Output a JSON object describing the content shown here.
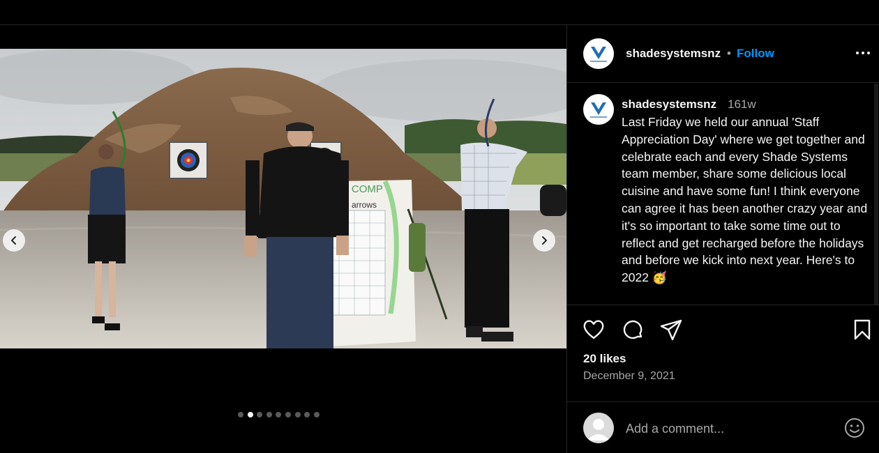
{
  "post": {
    "username": "shadesystemsnz",
    "follow_label": "Follow",
    "separator": "•",
    "caption_username": "shadesystemsnz",
    "time_ago": "161w",
    "caption": "Last Friday we held our annual 'Staff Appreciation Day' where we get together and celebrate each and every Shade Systems team member, share some delicious local cuisine and have some fun! I think everyone can agree it has been another crazy year and it's so important to take some time out to reflect and get recharged before the holidays and before we kick into next year. Here's to 2022 🥳",
    "likes": "20 likes",
    "date": "December 9, 2021"
  },
  "media": {
    "image_sign_text": "Y COMP",
    "image_sign_text2": "6 arrows",
    "carousel_count": 9,
    "carousel_active_index": 1
  },
  "comment": {
    "placeholder": "Add a comment..."
  },
  "icons": {
    "more": "more-options-icon",
    "like": "heart-icon",
    "comment": "comment-icon",
    "share": "share-icon",
    "save": "bookmark-icon",
    "emoji": "emoji-icon",
    "prev": "chevron-left-icon",
    "next": "chevron-right-icon"
  },
  "colors": {
    "background": "#000000",
    "follow": "#0095f6",
    "muted": "#a8a8a8",
    "text": "#f5f5f5",
    "brand_logo": "#1f6fb5"
  }
}
